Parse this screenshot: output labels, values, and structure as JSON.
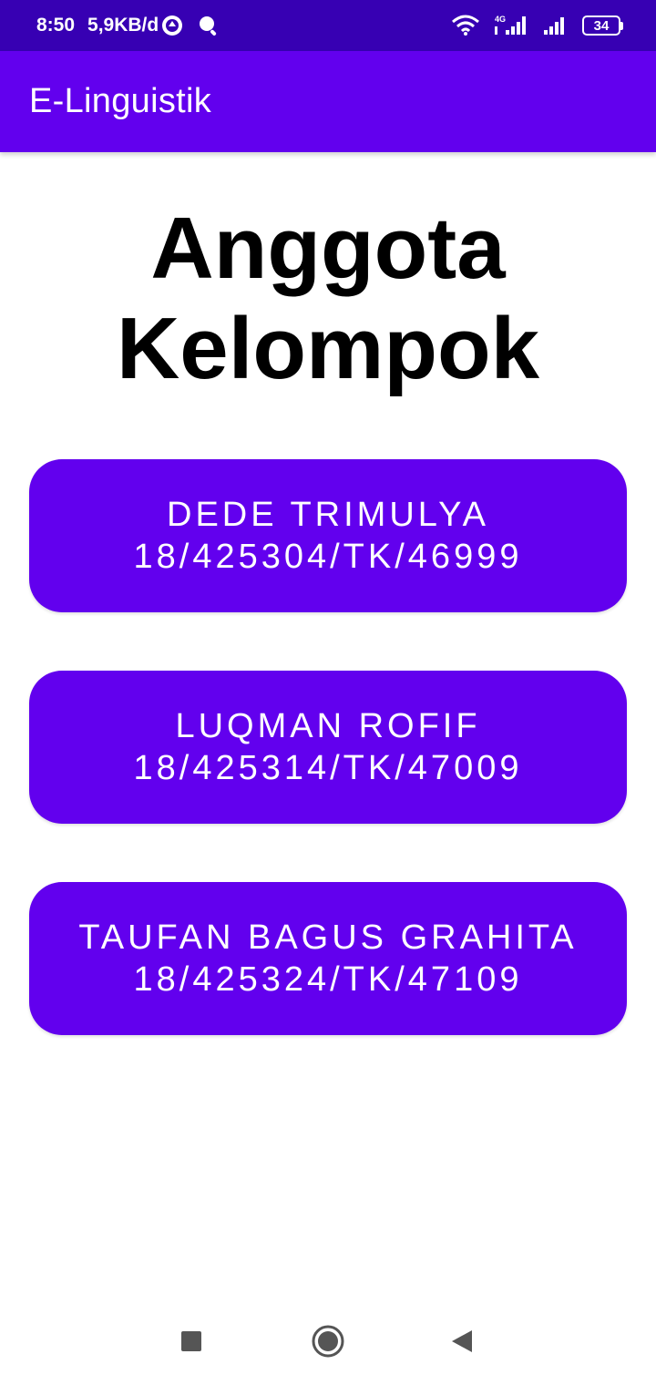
{
  "status_bar": {
    "time": "8:50",
    "network_speed": "5,9KB/d",
    "network_type": "4G",
    "battery_level": "34",
    "icons": [
      "app-notification-icon",
      "search-notification-icon",
      "wifi-icon",
      "signal-4g-icon",
      "signal-icon",
      "battery-icon"
    ]
  },
  "app_bar": {
    "title": "E-Linguistik"
  },
  "main": {
    "heading_line1": "Anggota",
    "heading_line2": "Kelompok",
    "members": [
      {
        "name": "DEDE TRIMULYA",
        "nim": "18/425304/TK/46999"
      },
      {
        "name": "LUQMAN ROFIF",
        "nim": "18/425314/TK/47009"
      },
      {
        "name": "TAUFAN BAGUS GRAHITA",
        "nim": "18/425324/TK/47109"
      }
    ]
  },
  "nav_bar": {
    "icons": [
      "recents-icon",
      "home-icon",
      "back-icon"
    ]
  },
  "colors": {
    "status_bar": "#3700B3",
    "primary": "#6200EE",
    "background": "#FFFFFF",
    "heading_text": "#000000"
  }
}
